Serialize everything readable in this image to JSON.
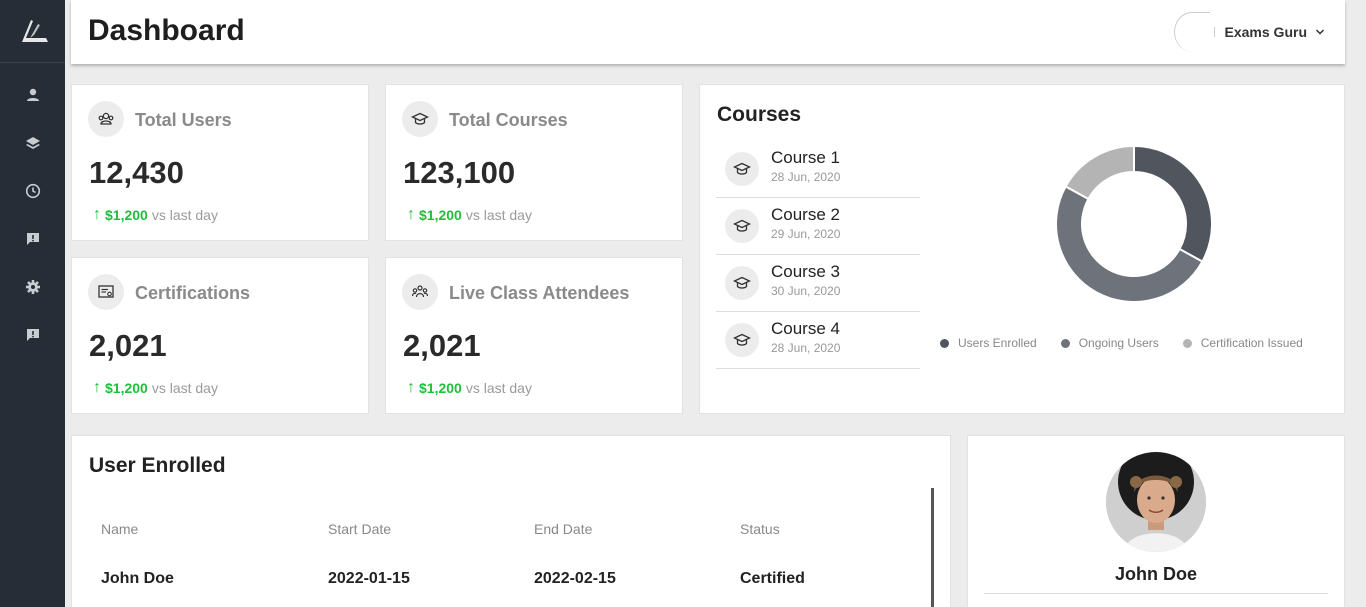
{
  "colors": {
    "sidebar": "#262d36",
    "accent_positive": "#1fbf3a",
    "chart_dark": "#50555e",
    "chart_mid": "#6e737b",
    "chart_light": "#b4b4b4"
  },
  "sidebar": {
    "logo": "brand-logo",
    "items": [
      {
        "icon": "user-icon"
      },
      {
        "icon": "layers-icon"
      },
      {
        "icon": "clock-icon"
      },
      {
        "icon": "chat-icon"
      },
      {
        "icon": "gear-icon"
      },
      {
        "icon": "feedback-icon"
      }
    ]
  },
  "header": {
    "title": "Dashboard",
    "user_name": "Exams Guru"
  },
  "stats": [
    {
      "label": "Total Users",
      "value": "12,430",
      "change": "$1,200",
      "suffix": "vs last day",
      "icon": "users-icon"
    },
    {
      "label": "Total Courses",
      "value": "123,100",
      "change": "$1,200",
      "suffix": "vs last day",
      "icon": "graduation-cap-icon"
    },
    {
      "label": "Certifications",
      "value": "2,021",
      "change": "$1,200",
      "suffix": "vs last day",
      "icon": "certificate-icon"
    },
    {
      "label": "Live Class Attendees",
      "value": "2,021",
      "change": "$1,200",
      "suffix": "vs last day",
      "icon": "group-icon"
    }
  ],
  "courses": {
    "title": "Courses",
    "items": [
      {
        "name": "Course 1",
        "date": "28 Jun, 2020"
      },
      {
        "name": "Course 2",
        "date": "29 Jun, 2020"
      },
      {
        "name": "Course 3",
        "date": "30 Jun, 2020"
      },
      {
        "name": "Course 4",
        "date": "28 Jun, 2020"
      }
    ],
    "legend": [
      "Users Enrolled",
      "Ongoing Users",
      "Certification Issued"
    ]
  },
  "chart_data": {
    "type": "pie",
    "categories": [
      "Users Enrolled",
      "Ongoing Users",
      "Certification Issued"
    ],
    "values": [
      33,
      50,
      17
    ],
    "donut": true,
    "legend_position": "bottom"
  },
  "enrolled": {
    "title": "User Enrolled",
    "columns": [
      "Name",
      "Start Date",
      "End Date",
      "Status"
    ],
    "rows": [
      [
        "John Doe",
        "2022-01-15",
        "2022-02-15",
        "Certified"
      ]
    ]
  },
  "profile": {
    "name": "John Doe"
  }
}
